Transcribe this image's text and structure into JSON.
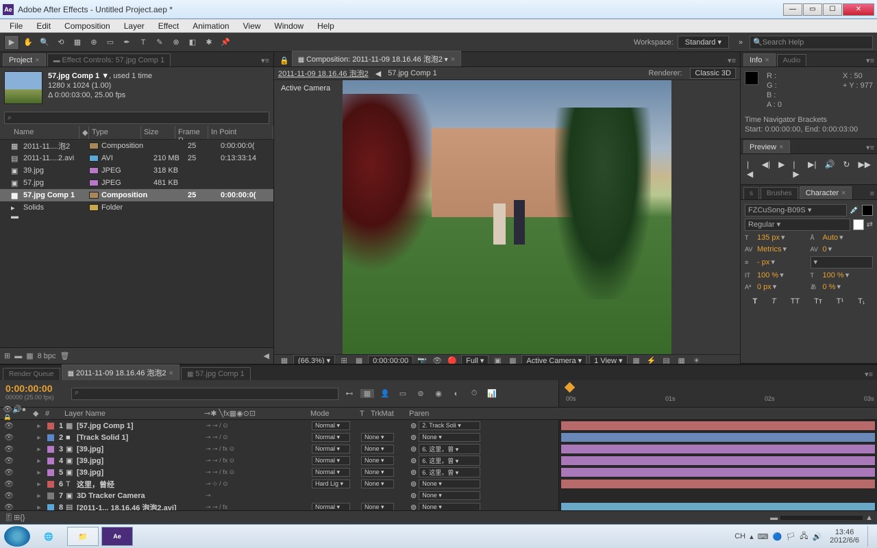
{
  "titlebar": {
    "title": "Adobe After Effects - Untitled Project.aep *",
    "icon": "Ae"
  },
  "menu": [
    "File",
    "Edit",
    "Composition",
    "Layer",
    "Effect",
    "Animation",
    "View",
    "Window",
    "Help"
  ],
  "toolbar": {
    "workspace_label": "Workspace:",
    "workspace_value": "Standard",
    "search_placeholder": "Search Help"
  },
  "project": {
    "tab_project": "Project",
    "tab_effect": "Effect Controls: 57.jpg Comp 1",
    "selected_name": "57.jpg Comp 1 ▼",
    "selected_used": ", used 1 time",
    "selected_dim": "1280 x 1024 (1.00)",
    "selected_dur": "Δ 0:00:03:00, 25.00 fps",
    "search_placeholder": "⌕",
    "cols": {
      "name": "Name",
      "type": "Type",
      "size": "Size",
      "fr": "Frame R...",
      "in": "In Point"
    },
    "items": [
      {
        "name": "2011-11....泡2",
        "type": "Composition",
        "size": "",
        "fr": "25",
        "in": "0:00:00:0(",
        "label": "#a88858",
        "ic": "▦"
      },
      {
        "name": "2011-11....2.avi",
        "type": "AVI",
        "size": "210 MB",
        "fr": "25",
        "in": "0:13:33:14",
        "label": "#5aa8d8",
        "ic": "▤"
      },
      {
        "name": "39.jpg",
        "type": "JPEG",
        "size": "318 KB",
        "fr": "",
        "in": "",
        "label": "#b878c8",
        "ic": "▣"
      },
      {
        "name": "57.jpg",
        "type": "JPEG",
        "size": "481 KB",
        "fr": "",
        "in": "",
        "label": "#b878c8",
        "ic": "▣"
      },
      {
        "name": "57.jpg Comp 1",
        "type": "Composition",
        "size": "",
        "fr": "25",
        "in": "0:00:00:0(",
        "label": "#a88858",
        "ic": "▦",
        "sel": true
      },
      {
        "name": "Solids",
        "type": "Folder",
        "size": "",
        "fr": "",
        "in": "",
        "label": "#c8a848",
        "ic": "▸ ▬"
      }
    ],
    "footer_bpc": "8 bpc"
  },
  "comp": {
    "tab": "Composition: 2011-11-09 18.16.46 泡泡2",
    "crumb1": "2011-11-09  18.16.46 泡泡2",
    "crumb2": "57.jpg Comp 1",
    "renderer_label": "Renderer:",
    "renderer_value": "Classic 3D",
    "active_camera": "Active Camera",
    "mag": "(66.3%)",
    "time": "0:00:00:00",
    "res": "Full",
    "view_cam": "Active Camera",
    "view_n": "1 View"
  },
  "info": {
    "tab_info": "Info",
    "tab_audio": "Audio",
    "r": "R :",
    "g": "G :",
    "b": "B :",
    "a": "A : 0",
    "x": "X : 50",
    "y": "+ Y : 977",
    "tnb": "Time Navigator Brackets",
    "tnb2": "Start: 0:00:00:00, End: 0:00:03:00"
  },
  "preview": {
    "tab": "Preview"
  },
  "character": {
    "tab_brush": "Brushes",
    "tab_char": "Character",
    "font": "FZCuSong-B09S",
    "style": "Regular",
    "size": "135 px",
    "leading": "Auto",
    "kern": "Metrics",
    "track": "0",
    "stroke": "- px",
    "vscale": "100 %",
    "hscale": "100 %",
    "baseline": "0 px",
    "tsume": "0 %"
  },
  "timeline": {
    "tab_rq": "Render Queue",
    "tab1": "2011-11-09  18.16.46 泡泡2",
    "tab2": "57.jpg Comp 1",
    "timecode": "0:00:00:00",
    "fps": "00000 (25.00 fps)",
    "search": "⌕",
    "ruler": [
      "00s",
      "01s",
      "02s",
      "03s"
    ],
    "cols": {
      "src": "Layer Name",
      "mode": "Mode",
      "t": "T",
      "trkmat": "TrkMat",
      "parent": "Paren"
    },
    "layers": [
      {
        "n": "1",
        "label": "#c85a5a",
        "ic": "▦",
        "name": "[57.jpg Comp 1]",
        "mode": "Normal",
        "trk": "",
        "parent": "2. Track Soli",
        "sw": "⊸ ⊸    /        ⊙",
        "bar": "#b86a6a"
      },
      {
        "n": "2",
        "label": "#5a88c8",
        "ic": "■",
        "name": "[Track Solid 1]",
        "mode": "Normal",
        "trk": "None",
        "parent": "None",
        "sw": "⊸ ⊸    /        ⊙",
        "bar": "#6a88b8"
      },
      {
        "n": "3",
        "label": "#b878c8",
        "ic": "▣",
        "name": "[39.jpg]",
        "mode": "Normal",
        "trk": "None",
        "parent": "6. 这里，曾",
        "sw": "⊸ ⊸    /  fx   ⊙",
        "bar": "#a878b8"
      },
      {
        "n": "4",
        "label": "#b878c8",
        "ic": "▣",
        "name": "[39.jpg]",
        "mode": "Normal",
        "trk": "None",
        "parent": "6. 这里，曾",
        "sw": "⊸ ⊸    /  fx   ⊙",
        "bar": "#a878b8"
      },
      {
        "n": "5",
        "label": "#b878c8",
        "ic": "▣",
        "name": "[39.jpg]",
        "mode": "Normal",
        "trk": "None",
        "parent": "6. 这里，曾",
        "sw": "⊸ ⊸    /  fx   ⊙",
        "bar": "#a878b8"
      },
      {
        "n": "6",
        "label": "#c85a5a",
        "ic": "T",
        "name": "这里，曾经",
        "mode": "Hard Lig",
        "trk": "None",
        "parent": "None",
        "sw": "⊸ ⊹    /        ⊙",
        "bar": "#b86a6a"
      },
      {
        "n": "7",
        "label": "#7a7a7a",
        "ic": "▣",
        "name": "3D Tracker Camera",
        "mode": "",
        "trk": "",
        "parent": "None",
        "sw": "⊸             ",
        "bar": ""
      },
      {
        "n": "8",
        "label": "#5aa8d8",
        "ic": "▤",
        "name": "[2011-1... 18.16.46 泡泡2.avi]",
        "mode": "Normal",
        "trk": "None",
        "parent": "None",
        "sw": "⊸ ⊸    /  fx   ",
        "bar": "#6aa8c8"
      }
    ]
  },
  "taskbar": {
    "lang": "CH",
    "clock_time": "13:46",
    "clock_date": "2012/6/6"
  }
}
